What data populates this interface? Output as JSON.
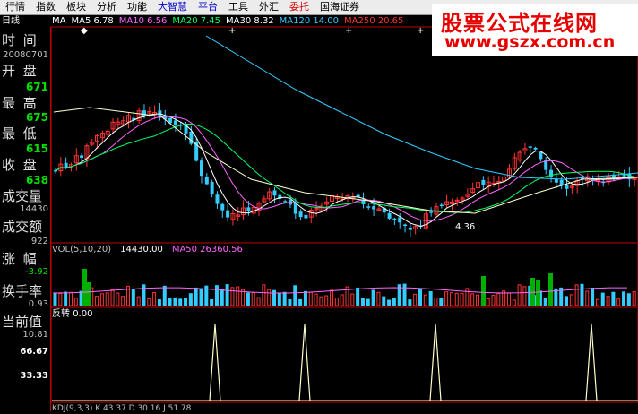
{
  "menu": [
    {
      "label": "行情",
      "color": "#000"
    },
    {
      "label": "指数",
      "color": "#000"
    },
    {
      "label": "板块",
      "color": "#000"
    },
    {
      "label": "分析",
      "color": "#000"
    },
    {
      "label": "功能",
      "color": "#000"
    },
    {
      "label": "大智慧",
      "color": "#0000c8"
    },
    {
      "label": "平台",
      "color": "#0000c8"
    },
    {
      "label": "工具",
      "color": "#000"
    },
    {
      "label": "外汇",
      "color": "#000"
    },
    {
      "label": "委托",
      "color": "#d00000"
    },
    {
      "label": "国海证券",
      "color": "#000"
    }
  ],
  "watermark": {
    "line1": "股票公式在线网",
    "line2": "www.gszx.com.cn"
  },
  "period_label": "日线",
  "ma_legend": [
    {
      "text": "MA",
      "color": "#ffffff"
    },
    {
      "text": "MA5 6.78",
      "color": "#ffffff"
    },
    {
      "text": "MA10 6.56",
      "color": "#ff66ff"
    },
    {
      "text": "MA20 7.45",
      "color": "#00ff66"
    },
    {
      "text": "MA30 8.32",
      "color": "#ffffff"
    },
    {
      "text": "MA120 14.00",
      "color": "#33ccff"
    },
    {
      "text": "MA250 20.65",
      "color": "#ff3333"
    }
  ],
  "info": {
    "time_label": "时 间",
    "date": "20080701",
    "open_label": "开 盘",
    "open": "671",
    "high_label": "最 高",
    "high": "675",
    "low_label": "最 低",
    "low": "615",
    "close_label": "收 盘",
    "close": "638",
    "volume_label": "成交量",
    "volume": "14430",
    "amount_label": "成交额",
    "amount": "922",
    "change_label": "涨 幅",
    "change": "-3.92",
    "turnover_label": "换手率",
    "turnover": "0.93",
    "current_label": "当前值",
    "current": "10.81"
  },
  "price_min_label": "4.36",
  "vol_header": [
    {
      "text": "VOL(5,10,20)",
      "color": "#c0c0c0"
    },
    {
      "text": "14430.00",
      "color": "#ffffff"
    },
    {
      "text": "MA50 26360.56",
      "color": "#ff66ff"
    }
  ],
  "indicator_header": {
    "name": "反转",
    "value": "0.00"
  },
  "indicator_axis": [
    "66.67",
    "33.33"
  ],
  "bottom_header": {
    "text": "KDJ(9,3,3)  K 43.37  D 30.16  J 51.78"
  },
  "colors": {
    "up": "#ff3333",
    "down": "#33ccff",
    "volspike": "#00b000",
    "border": "#c00000"
  }
}
